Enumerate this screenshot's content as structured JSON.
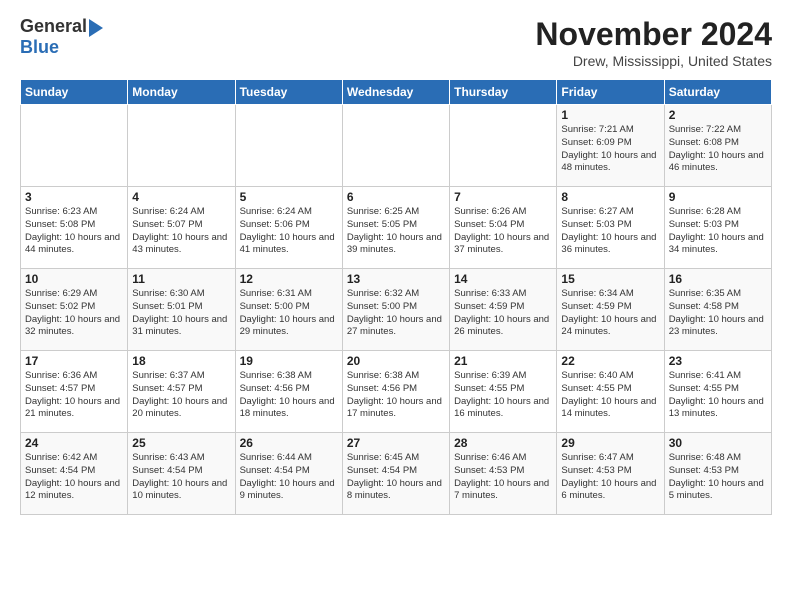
{
  "header": {
    "logo_general": "General",
    "logo_blue": "Blue",
    "month": "November 2024",
    "location": "Drew, Mississippi, United States"
  },
  "weekdays": [
    "Sunday",
    "Monday",
    "Tuesday",
    "Wednesday",
    "Thursday",
    "Friday",
    "Saturday"
  ],
  "weeks": [
    [
      {
        "day": "",
        "info": ""
      },
      {
        "day": "",
        "info": ""
      },
      {
        "day": "",
        "info": ""
      },
      {
        "day": "",
        "info": ""
      },
      {
        "day": "",
        "info": ""
      },
      {
        "day": "1",
        "info": "Sunrise: 7:21 AM\nSunset: 6:09 PM\nDaylight: 10 hours\nand 48 minutes."
      },
      {
        "day": "2",
        "info": "Sunrise: 7:22 AM\nSunset: 6:08 PM\nDaylight: 10 hours\nand 46 minutes."
      }
    ],
    [
      {
        "day": "3",
        "info": "Sunrise: 6:23 AM\nSunset: 5:08 PM\nDaylight: 10 hours\nand 44 minutes."
      },
      {
        "day": "4",
        "info": "Sunrise: 6:24 AM\nSunset: 5:07 PM\nDaylight: 10 hours\nand 43 minutes."
      },
      {
        "day": "5",
        "info": "Sunrise: 6:24 AM\nSunset: 5:06 PM\nDaylight: 10 hours\nand 41 minutes."
      },
      {
        "day": "6",
        "info": "Sunrise: 6:25 AM\nSunset: 5:05 PM\nDaylight: 10 hours\nand 39 minutes."
      },
      {
        "day": "7",
        "info": "Sunrise: 6:26 AM\nSunset: 5:04 PM\nDaylight: 10 hours\nand 37 minutes."
      },
      {
        "day": "8",
        "info": "Sunrise: 6:27 AM\nSunset: 5:03 PM\nDaylight: 10 hours\nand 36 minutes."
      },
      {
        "day": "9",
        "info": "Sunrise: 6:28 AM\nSunset: 5:03 PM\nDaylight: 10 hours\nand 34 minutes."
      }
    ],
    [
      {
        "day": "10",
        "info": "Sunrise: 6:29 AM\nSunset: 5:02 PM\nDaylight: 10 hours\nand 32 minutes."
      },
      {
        "day": "11",
        "info": "Sunrise: 6:30 AM\nSunset: 5:01 PM\nDaylight: 10 hours\nand 31 minutes."
      },
      {
        "day": "12",
        "info": "Sunrise: 6:31 AM\nSunset: 5:00 PM\nDaylight: 10 hours\nand 29 minutes."
      },
      {
        "day": "13",
        "info": "Sunrise: 6:32 AM\nSunset: 5:00 PM\nDaylight: 10 hours\nand 27 minutes."
      },
      {
        "day": "14",
        "info": "Sunrise: 6:33 AM\nSunset: 4:59 PM\nDaylight: 10 hours\nand 26 minutes."
      },
      {
        "day": "15",
        "info": "Sunrise: 6:34 AM\nSunset: 4:59 PM\nDaylight: 10 hours\nand 24 minutes."
      },
      {
        "day": "16",
        "info": "Sunrise: 6:35 AM\nSunset: 4:58 PM\nDaylight: 10 hours\nand 23 minutes."
      }
    ],
    [
      {
        "day": "17",
        "info": "Sunrise: 6:36 AM\nSunset: 4:57 PM\nDaylight: 10 hours\nand 21 minutes."
      },
      {
        "day": "18",
        "info": "Sunrise: 6:37 AM\nSunset: 4:57 PM\nDaylight: 10 hours\nand 20 minutes."
      },
      {
        "day": "19",
        "info": "Sunrise: 6:38 AM\nSunset: 4:56 PM\nDaylight: 10 hours\nand 18 minutes."
      },
      {
        "day": "20",
        "info": "Sunrise: 6:38 AM\nSunset: 4:56 PM\nDaylight: 10 hours\nand 17 minutes."
      },
      {
        "day": "21",
        "info": "Sunrise: 6:39 AM\nSunset: 4:55 PM\nDaylight: 10 hours\nand 16 minutes."
      },
      {
        "day": "22",
        "info": "Sunrise: 6:40 AM\nSunset: 4:55 PM\nDaylight: 10 hours\nand 14 minutes."
      },
      {
        "day": "23",
        "info": "Sunrise: 6:41 AM\nSunset: 4:55 PM\nDaylight: 10 hours\nand 13 minutes."
      }
    ],
    [
      {
        "day": "24",
        "info": "Sunrise: 6:42 AM\nSunset: 4:54 PM\nDaylight: 10 hours\nand 12 minutes."
      },
      {
        "day": "25",
        "info": "Sunrise: 6:43 AM\nSunset: 4:54 PM\nDaylight: 10 hours\nand 10 minutes."
      },
      {
        "day": "26",
        "info": "Sunrise: 6:44 AM\nSunset: 4:54 PM\nDaylight: 10 hours\nand 9 minutes."
      },
      {
        "day": "27",
        "info": "Sunrise: 6:45 AM\nSunset: 4:54 PM\nDaylight: 10 hours\nand 8 minutes."
      },
      {
        "day": "28",
        "info": "Sunrise: 6:46 AM\nSunset: 4:53 PM\nDaylight: 10 hours\nand 7 minutes."
      },
      {
        "day": "29",
        "info": "Sunrise: 6:47 AM\nSunset: 4:53 PM\nDaylight: 10 hours\nand 6 minutes."
      },
      {
        "day": "30",
        "info": "Sunrise: 6:48 AM\nSunset: 4:53 PM\nDaylight: 10 hours\nand 5 minutes."
      }
    ]
  ]
}
